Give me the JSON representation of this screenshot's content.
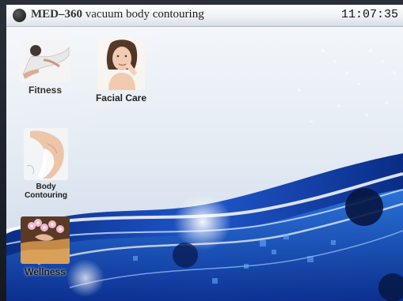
{
  "titlebar": {
    "model": "MED–360",
    "subtitle": "vacuum body contouring",
    "time": "11:07:35"
  },
  "apps": {
    "fitness": {
      "label": "Fitness",
      "icon": "fitness-icon"
    },
    "facial_care": {
      "label": "Facial Care",
      "icon": "facial-care-icon"
    },
    "body_contouring": {
      "label_line1": "Body",
      "label_line2": "Contouring",
      "icon": "body-contouring-icon"
    },
    "wellness": {
      "label": "Wellness",
      "icon": "wellness-icon"
    }
  },
  "colors": {
    "wallpaper_light": "#e9eef4",
    "wave_blue": "#1f56c9",
    "wave_dark": "#0a2d86",
    "title_text": "#111111"
  }
}
